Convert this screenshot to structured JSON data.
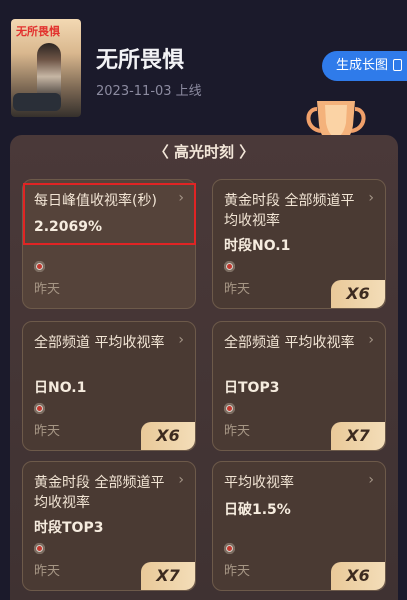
{
  "show": {
    "title": "无所畏惧",
    "poster_text": "无所畏惧",
    "date": "2023-11-03 上线",
    "generate_btn": "生成长图"
  },
  "section": {
    "title": "〈 高光时刻 〉"
  },
  "cards": [
    {
      "title": "每日峰值收视率(秒)",
      "value": "2.2069%",
      "date": "昨天",
      "multiplier": ""
    },
    {
      "title": "黄金时段 全部频道平均收视率",
      "value": "时段NO.1",
      "date": "昨天",
      "multiplier": "X6"
    },
    {
      "title": "全部频道 平均收视率",
      "value": "日NO.1",
      "date": "昨天",
      "multiplier": "X6"
    },
    {
      "title": "全部频道 平均收视率",
      "value": "日TOP3",
      "date": "昨天",
      "multiplier": "X7"
    },
    {
      "title": "黄金时段 全部频道平均收视率",
      "value": "时段TOP3",
      "date": "昨天",
      "multiplier": "X7"
    },
    {
      "title": "平均收视率",
      "value": "日破1.5%",
      "date": "昨天",
      "multiplier": "X6"
    }
  ],
  "colors": {
    "background": "#1b1a2b",
    "panel": "#453535",
    "accent_button": "#2f7bea",
    "badge": "#f0d3a6",
    "highlight_border": "#e02424"
  },
  "icons": {
    "arrow": "chevron-right-icon",
    "source": "source-logo-icon",
    "trophy": "trophy-icon",
    "generate": "image-icon"
  }
}
